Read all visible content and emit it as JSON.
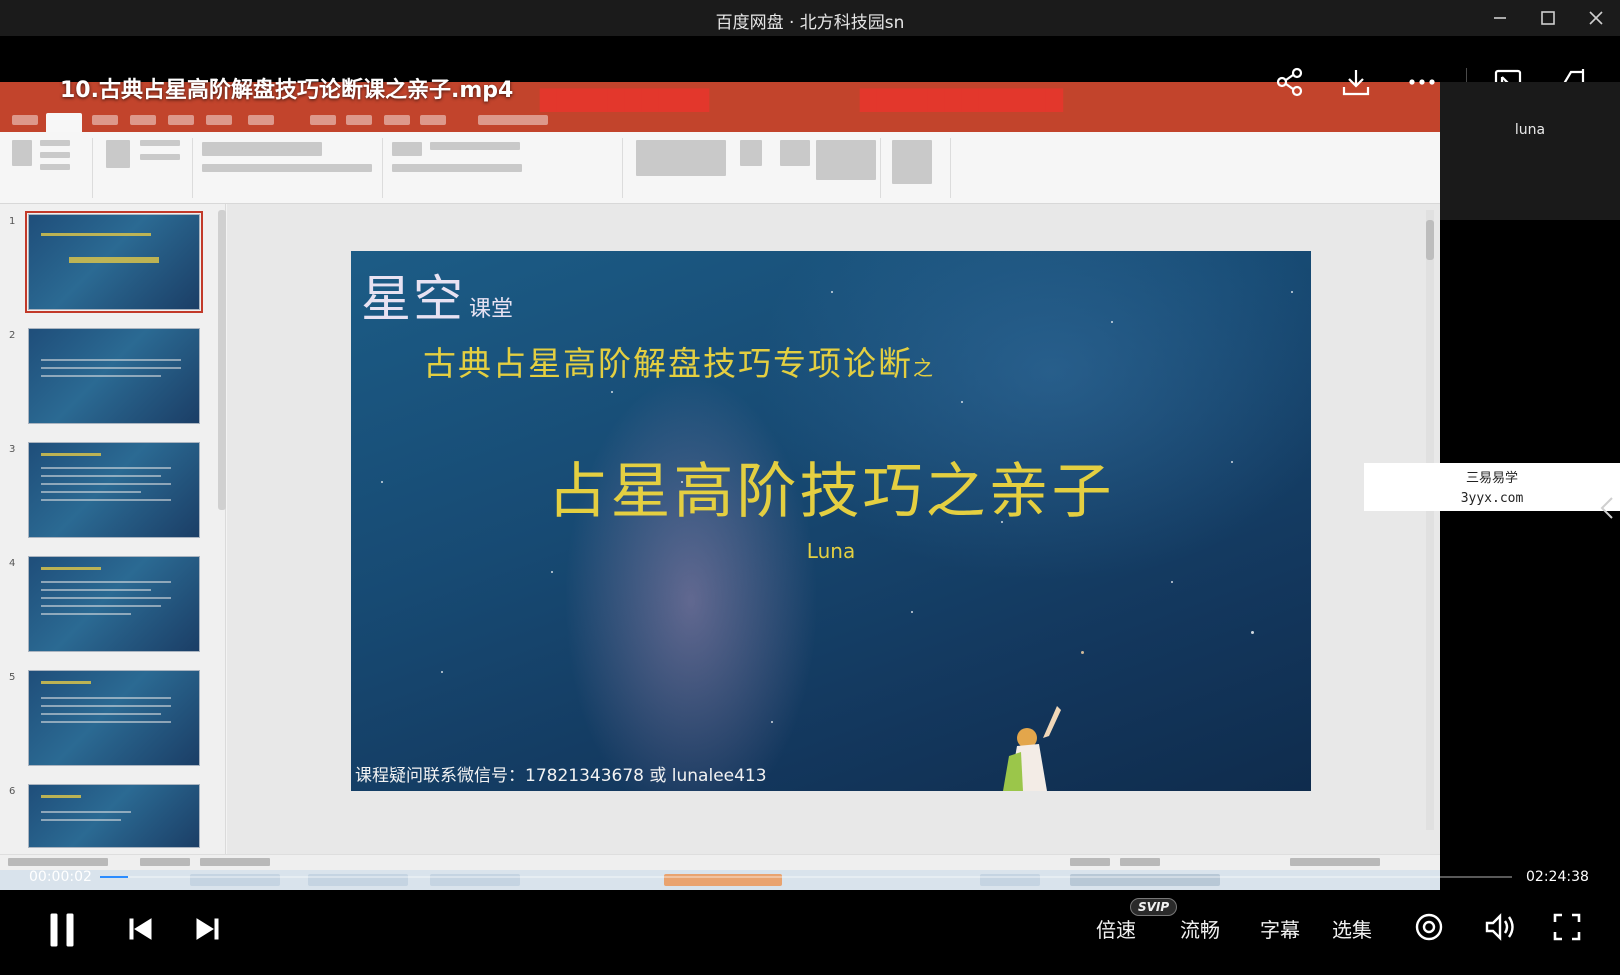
{
  "window": {
    "title": "百度网盘 · 北方科技园sn"
  },
  "video": {
    "title": "10.古典占星高阶解盘技巧论断课之亲子.mp4",
    "side_user_name": "luna",
    "watermark_line1": "三易易学",
    "watermark_line2": "3yyx.com",
    "current_time": "00:00:02",
    "total_time": "02:24:38",
    "progress_fraction": 0.0002
  },
  "slide": {
    "brand_big": "星空",
    "brand_small": "课堂",
    "subtitle": "古典占星高阶解盘技巧专项论断",
    "subtitle_suffix": "之",
    "main_title": "占星高阶技巧之亲子",
    "author": "Luna",
    "contact": "课程疑问联系微信号：17821343678 或 lunalee413"
  },
  "thumbnails": [
    "1",
    "2",
    "3",
    "4",
    "5",
    "6"
  ],
  "controls": {
    "speed_label": "倍速",
    "svip_badge": "SVIP",
    "quality_label": "流畅",
    "subtitle_label": "字幕",
    "episodes_label": "选集"
  },
  "icons": {
    "share": "share-icon",
    "download": "download-icon",
    "more": "more-icon",
    "picture_in_picture": "pip-icon",
    "pin": "pin-icon",
    "pause": "pause-icon",
    "previous": "previous-icon",
    "next": "next-icon",
    "view": "view-icon",
    "volume": "volume-icon",
    "fullscreen": "fullscreen-icon"
  },
  "colors": {
    "accent": "#2b8cff",
    "slide_gold": "#e4cf41",
    "ppt_red": "#c2442c"
  }
}
